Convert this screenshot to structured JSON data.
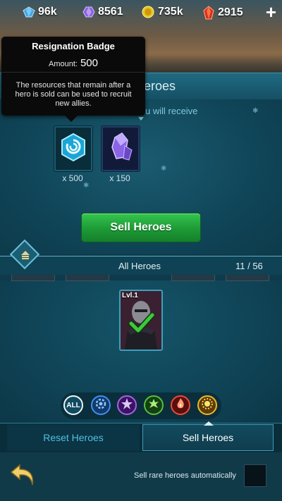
{
  "resources": [
    {
      "icon": "blue-crystal-icon",
      "value": "96k"
    },
    {
      "icon": "purple-gem-icon",
      "value": "8561"
    },
    {
      "icon": "gold-coin-icon",
      "value": "735k"
    },
    {
      "icon": "red-ruby-icon",
      "value": "2915"
    }
  ],
  "add_label": "+",
  "header": {
    "title_visible": "heroes",
    "subtitle_visible": "u will receive"
  },
  "tooltip": {
    "title": "Resignation Badge",
    "amount_label": "Amount:",
    "amount_value": "500",
    "description": "The resources that remain after a hero is sold can be used to recruit new allies."
  },
  "rewards": [
    {
      "icon": "resignation-badge-icon",
      "count": "x 500"
    },
    {
      "icon": "purple-crystal-icon",
      "count": "x 150"
    }
  ],
  "sell_button_label": "Sell Heroes",
  "hero_list": {
    "label": "All Heroes",
    "count": "11 / 56"
  },
  "heroes": [
    {
      "level": "Lvl.1",
      "selected": true
    }
  ],
  "filters": [
    {
      "id": "all",
      "label": "ALL",
      "icon": "all-filter-icon",
      "color": "#e9f6fb"
    },
    {
      "id": "water",
      "icon": "blue-gear-icon",
      "color": "#2f7fe0"
    },
    {
      "id": "arcane",
      "icon": "purple-star-icon",
      "color": "#9b46d8"
    },
    {
      "id": "nature",
      "icon": "green-leaf-icon",
      "color": "#3fae2e"
    },
    {
      "id": "fire",
      "icon": "red-flame-icon",
      "color": "#e0342a"
    },
    {
      "id": "light",
      "icon": "gold-sun-icon",
      "color": "#e6a51c"
    }
  ],
  "tabs": [
    {
      "label": "Reset Heroes",
      "active": false
    },
    {
      "label": "Sell Heroes",
      "active": true
    }
  ],
  "footer": {
    "auto_sell_label": "Sell rare heroes automatically",
    "auto_sell_checked": false
  },
  "colors": {
    "accent_green": "#26a93e",
    "panel": "#0f4356",
    "selected_check": "#3ec93a"
  }
}
